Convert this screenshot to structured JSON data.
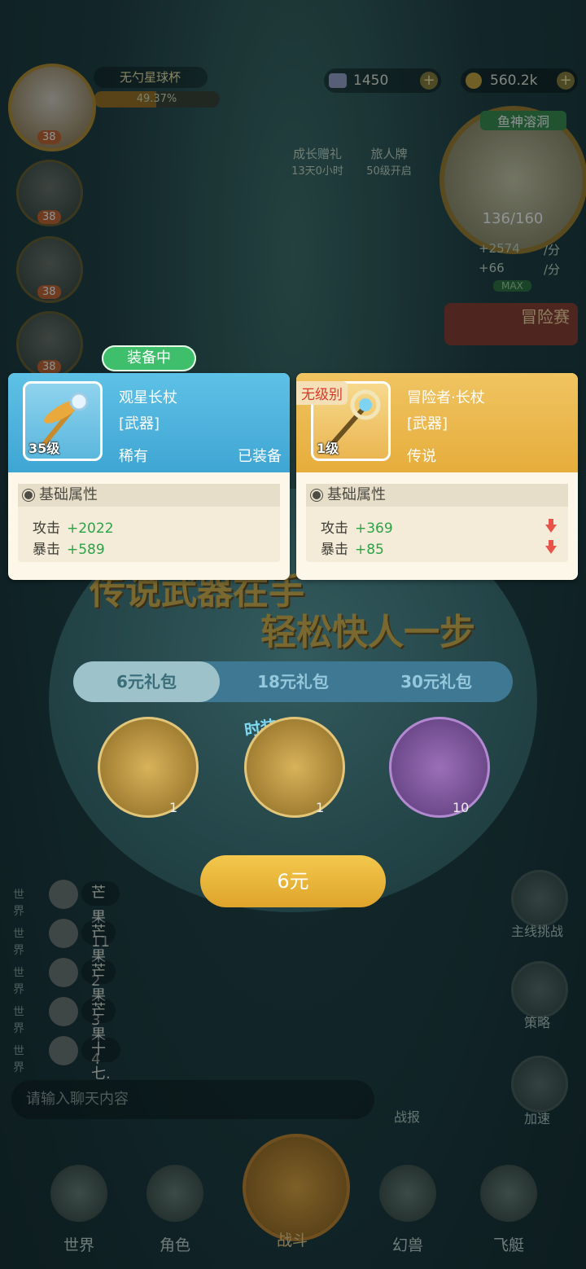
{
  "player": {
    "level": "38",
    "title": "无勺星球杯",
    "progress_text": "49.37%",
    "progress": 0.4937
  },
  "resources": {
    "gems": "1450",
    "gold": "560.2k"
  },
  "team_levels": [
    "38",
    "38",
    "38"
  ],
  "events": {
    "growth_gift": {
      "label": "成长赠礼",
      "timer": "13天0小时"
    },
    "traveler": {
      "label": "旅人牌",
      "note": "50级开启"
    }
  },
  "map": {
    "name": "鱼神溶洞",
    "count": "136/160",
    "rate1": "+2574",
    "rate2": "+66",
    "unit": "/分",
    "max": "MAX",
    "adventure": "冒险赛"
  },
  "popup": {
    "equipped_badge": "装备中",
    "left": {
      "level": "35级",
      "name": "观星长杖",
      "type": "[武器]",
      "rarity": "稀有",
      "status": "已装备",
      "attr_title": "基础属性",
      "attrs": [
        {
          "label": "攻击",
          "value": "+2022"
        },
        {
          "label": "暴击",
          "value": "+589"
        }
      ]
    },
    "right": {
      "tag": "无级别",
      "level": "1级",
      "name": "冒险者·长杖",
      "type": "[武器]",
      "rarity": "传说",
      "attr_title": "基础属性",
      "attrs": [
        {
          "label": "攻击",
          "value": "+369"
        },
        {
          "label": "暴击",
          "value": "+85"
        }
      ]
    }
  },
  "promo": {
    "line1": "传说武器在手",
    "line2": "轻松快人一步",
    "tabs": [
      "6元礼包",
      "18元礼包",
      "30元礼包"
    ],
    "fashion_tag": "时装",
    "items": [
      {
        "count": "1"
      },
      {
        "count": "1"
      },
      {
        "count": "10"
      }
    ],
    "buy_label": "6元"
  },
  "chat": {
    "channel": "世界",
    "rows": [
      {
        "name": "芒果11"
      },
      {
        "name": "芒果2"
      },
      {
        "name": "芒果3"
      },
      {
        "name": "芒果4"
      },
      {
        "name": "十七."
      }
    ],
    "placeholder": "请输入聊天内容",
    "report": "战报"
  },
  "right_menu": [
    "主线挑战",
    "策略",
    "加速"
  ],
  "bottom_nav": [
    "世界",
    "角色",
    "战斗",
    "幻兽",
    "飞艇"
  ]
}
